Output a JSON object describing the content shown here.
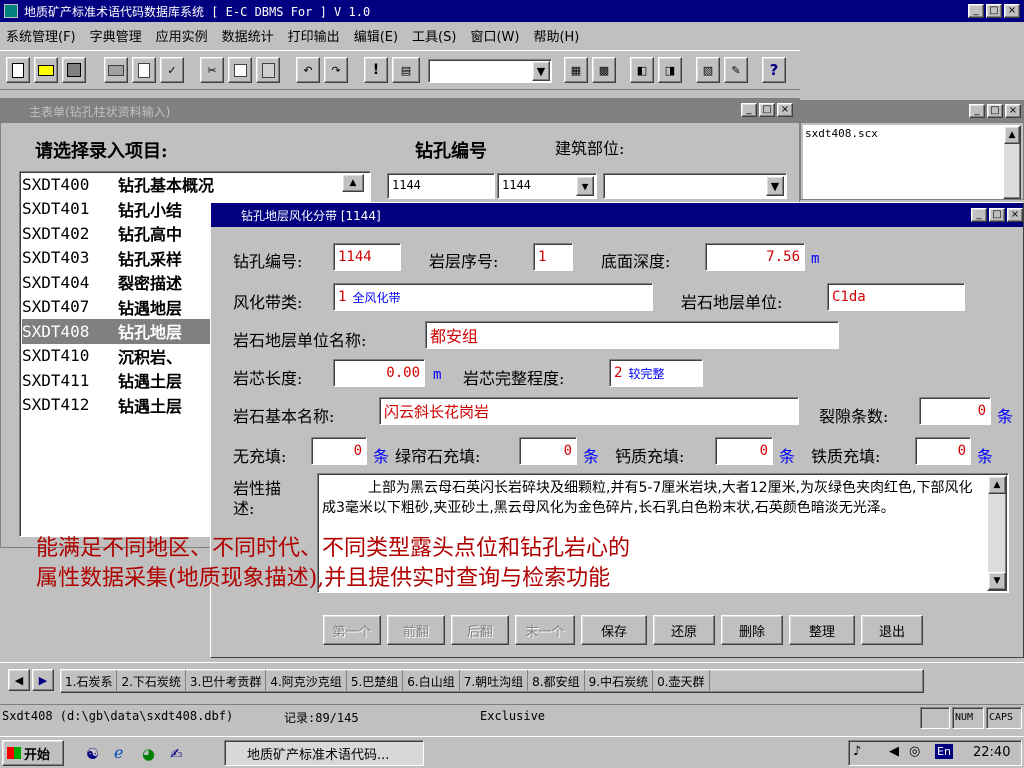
{
  "app": {
    "title": "地质矿产标准术语代码数据库系统   [ E-C DBMS For  ] V 1.0",
    "menu": [
      "系统管理(F)",
      "字典管理",
      "应用实例",
      "数据统计",
      "打印输出",
      "编辑(E)",
      "工具(S)",
      "窗口(W)",
      "帮助(H)"
    ],
    "window_controls": [
      "_",
      "□",
      "×"
    ]
  },
  "toolbar": {
    "icons": [
      "new-doc-icon",
      "open-folder-icon",
      "save-icon",
      "print-icon",
      "print-preview-icon",
      "spell-check-icon",
      "cut-icon",
      "copy-icon",
      "paste-icon",
      "undo-icon",
      "redo-icon",
      "run-icon",
      "modify-icon"
    ],
    "combo_value": "",
    "icons_right": [
      "form-icon",
      "report-icon",
      "database-icon",
      "query-icon",
      "wizard-icon",
      "edit-icon",
      "help-icon"
    ],
    "help_glyph": "?"
  },
  "main_form": {
    "title": "主表单(钻孔柱状资料输入)",
    "select_label": "请选择录入项目:",
    "hole_label": "钻孔编号",
    "site_label": "建筑部位:",
    "hole_value": "1144",
    "hole_combo": "1144",
    "items": [
      {
        "code": "SXDT400",
        "name": "钻孔基本概况"
      },
      {
        "code": "SXDT401",
        "name": "钻孔小结"
      },
      {
        "code": "SXDT402",
        "name": "钻孔高中"
      },
      {
        "code": "SXDT403",
        "name": "钻孔采样"
      },
      {
        "code": "SXDT404",
        "name": "裂密描述"
      },
      {
        "code": "SXDT407",
        "name": "钻遇地层"
      },
      {
        "code": "SXDT408",
        "name": "钻孔地层"
      },
      {
        "code": "SXDT410",
        "name": "沉积岩、"
      },
      {
        "code": "SXDT411",
        "name": "钻遇土层"
      },
      {
        "code": "SXDT412",
        "name": "钻遇土层"
      }
    ]
  },
  "file_panel": {
    "filename": "sxdt408.scx"
  },
  "dialog": {
    "title": "钻孔地层风化分带   [1144]",
    "hole_no_label": "钻孔编号:",
    "hole_no": "1144",
    "layer_seq_label": "岩层序号:",
    "layer_seq": "1",
    "depth_label": "底面深度:",
    "depth": "7.56",
    "depth_unit": "m",
    "weather_label": "风化带类:",
    "weather_code": "1",
    "weather_name": "全风化带",
    "strat_unit_label": "岩石地层单位:",
    "strat_unit": "C1da",
    "strat_name_label": "岩石地层单位名称:",
    "strat_name": "都安组",
    "core_len_label": "岩芯长度:",
    "core_len": "0.00",
    "core_len_unit": "m",
    "integrity_label": "岩芯完整程度:",
    "integrity_code": "2",
    "integrity_name": "较完整",
    "rock_name_label": "岩石基本名称:",
    "rock_name": "闪云斜长花岗岩",
    "fracture_label": "裂隙条数:",
    "fracture": "0",
    "unit_tiao": "条",
    "no_fill_label": "无充填:",
    "no_fill": "0",
    "epidote_label": "绿帘石充填:",
    "epidote": "0",
    "calc_label": "钙质充填:",
    "calc": "0",
    "iron_label": "铁质充填:",
    "iron": "0",
    "desc_label": "岩性描述:",
    "desc": "上部为黑云母石英闪长岩碎块及细颗粒,并有5-7厘米岩块,大者12厘米,为灰绿色夹肉红色,下部风化成3毫米以下粗砂,夹亚砂土,黑云母风化为金色碎片,长石乳白色粉末状,石英颜色暗淡无光泽。",
    "buttons": [
      {
        "label": "第一个",
        "enabled": false
      },
      {
        "label": "前翻",
        "enabled": false
      },
      {
        "label": "后翻",
        "enabled": false
      },
      {
        "label": "末一个",
        "enabled": false
      },
      {
        "label": "保存",
        "enabled": true
      },
      {
        "label": "还原",
        "enabled": true
      },
      {
        "label": "删除",
        "enabled": true
      },
      {
        "label": "整理",
        "enabled": true
      },
      {
        "label": "退出",
        "enabled": true
      }
    ]
  },
  "caption": {
    "line1": "能满足不同地区、不同时代、不同类型露头点位和钻孔岩心的",
    "line2": "属性数据采集(地质现象描述),并且提供实时查询与检索功能"
  },
  "tabs": [
    "1.石炭系",
    "2.下石炭统",
    "3.巴什考贡群",
    "4.阿克沙克组",
    "5.巴楚组",
    "6.白山组",
    "7.朝吐沟组",
    "8.都安组",
    "9.中石炭统",
    "0.壶天群"
  ],
  "status": {
    "path": "Sxdt408 (d:\\gb\\data\\sxdt408.dbf)",
    "record": "记录:89/145",
    "mode": "Exclusive",
    "num": "NUM",
    "caps": "CAPS"
  },
  "taskbar": {
    "start": "开始",
    "task": "地质矿产标准术语代码...",
    "lang": "En",
    "time": "22:40"
  },
  "colors": {
    "title_active": "#000080",
    "title_inactive": "#808080",
    "face": "#c0c0c0",
    "value_red": "#d00000",
    "caption_red": "#b00000"
  }
}
